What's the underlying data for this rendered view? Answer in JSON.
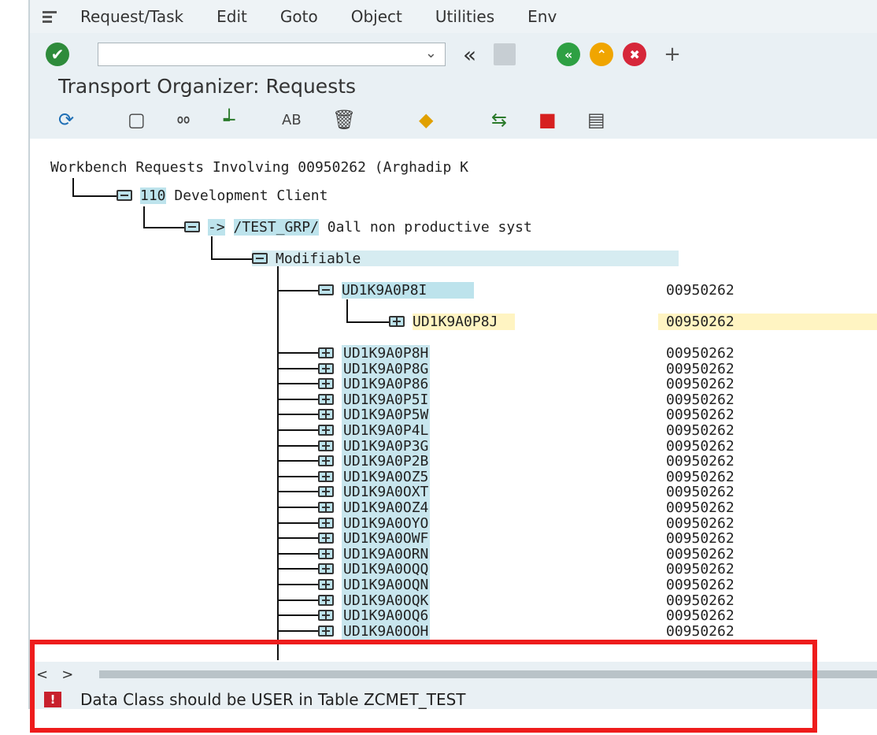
{
  "menubar": {
    "icon": "menu-icon",
    "items": [
      "Request/Task",
      "Edit",
      "Goto",
      "Object",
      "Utilities",
      "Env"
    ]
  },
  "toolbar": {
    "enter_icon": "checkmark-icon",
    "command_value": "",
    "dropdown_icon": "chevron-down-icon",
    "back_double_icon": "double-chevron-left-icon",
    "save_icon": "save-icon",
    "back_icon": "back-icon",
    "exit_icon": "exit-icon",
    "cancel_icon": "cancel-icon",
    "more_icon": "more-icon"
  },
  "title": "Transport Organizer: Requests",
  "app_toolbar": {
    "icons": [
      "refresh-icon",
      "create-icon",
      "display-icon",
      "hierarchy-icon",
      "rename-icon",
      "delete-icon",
      "lock-icon",
      "transfer-icon",
      "release-icon",
      "document-icon"
    ]
  },
  "tree": {
    "header": "Workbench Requests Involving 00950262 (Arghadip K",
    "client_code": "110",
    "client_label": "Development Client",
    "target_arrow": "->",
    "target": "/TEST_GRP/",
    "target_desc": "0all non productive syst",
    "status_label": "Modifiable",
    "parent_request": {
      "id": "UD1K9A0P8I",
      "owner": "00950262"
    },
    "task": {
      "id": "UD1K9A0P8J",
      "owner": "00950262"
    },
    "requests": [
      {
        "id": "UD1K9A0P8H",
        "owner": "00950262"
      },
      {
        "id": "UD1K9A0P8G",
        "owner": "00950262"
      },
      {
        "id": "UD1K9A0P86",
        "owner": "00950262"
      },
      {
        "id": "UD1K9A0P5I",
        "owner": "00950262"
      },
      {
        "id": "UD1K9A0P5W",
        "owner": "00950262"
      },
      {
        "id": "UD1K9A0P4L",
        "owner": "00950262"
      },
      {
        "id": "UD1K9A0P3G",
        "owner": "00950262"
      },
      {
        "id": "UD1K9A0P2B",
        "owner": "00950262"
      },
      {
        "id": "UD1K9A0OZ5",
        "owner": "00950262"
      },
      {
        "id": "UD1K9A0OXT",
        "owner": "00950262"
      },
      {
        "id": "UD1K9A0OZ4",
        "owner": "00950262"
      },
      {
        "id": "UD1K9A0OYO",
        "owner": "00950262"
      },
      {
        "id": "UD1K9A0OWF",
        "owner": "00950262"
      },
      {
        "id": "UD1K9A0ORN",
        "owner": "00950262"
      },
      {
        "id": "UD1K9A0OQQ",
        "owner": "00950262"
      },
      {
        "id": "UD1K9A0OQN",
        "owner": "00950262"
      },
      {
        "id": "UD1K9A0OQK",
        "owner": "00950262"
      },
      {
        "id": "UD1K9A0OQ6",
        "owner": "00950262"
      },
      {
        "id": "UD1K9A0OOH",
        "owner": "00950262"
      }
    ]
  },
  "scroll": {
    "left": "<",
    "right": ">"
  },
  "status": {
    "icon": "error-icon",
    "badge": "!",
    "message": "Data Class should be USER in Table ZCMET_TEST"
  },
  "colors": {
    "error": "#c8202c",
    "highlight_box": "#ee1c1c",
    "selection": "#bde3ec",
    "focus": "#fff4c2"
  }
}
